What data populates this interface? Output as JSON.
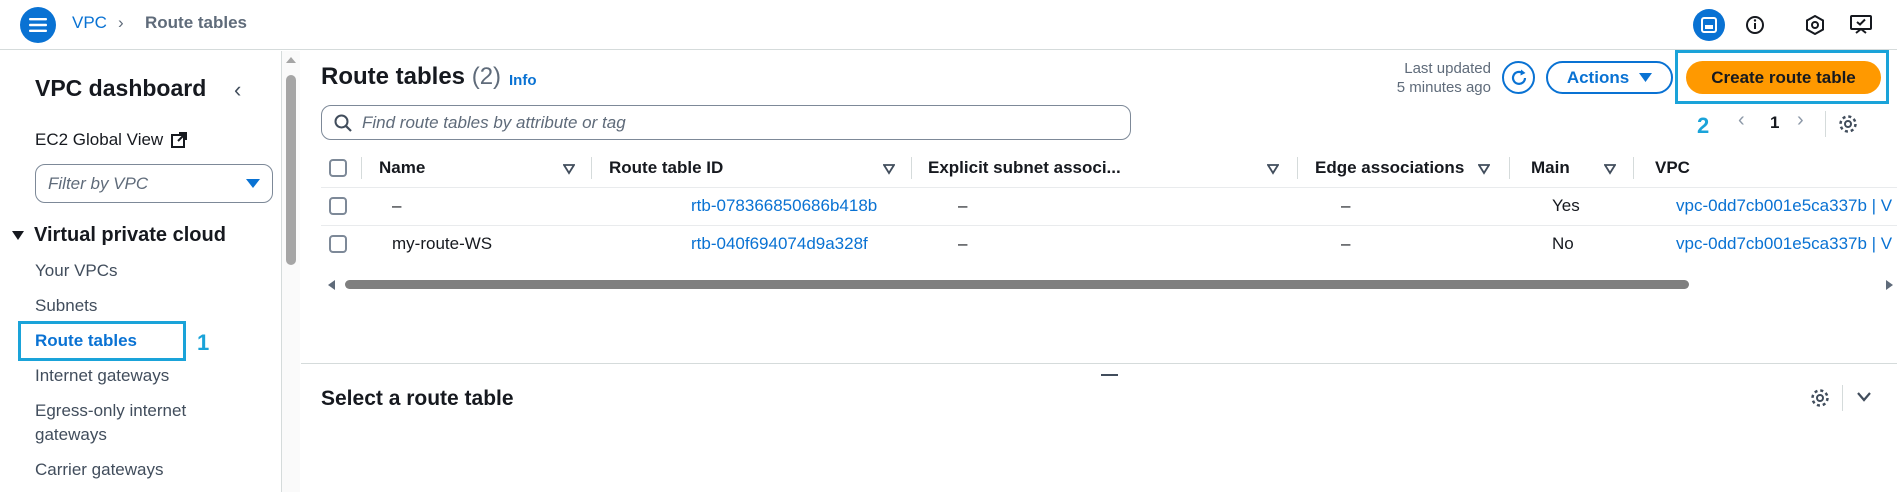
{
  "topbar": {
    "crumbs": [
      "VPC",
      "Route tables"
    ],
    "icons": [
      "menu-icon",
      "panel-icon",
      "info-circle-icon",
      "settings-hex-icon",
      "feedback-icon"
    ]
  },
  "sidebar": {
    "title": "VPC dashboard",
    "global_view": "EC2 Global View",
    "filter_placeholder": "Filter by VPC",
    "section": "Virtual private cloud",
    "items": [
      "Your VPCs",
      "Subnets",
      "Route tables",
      "Internet gateways",
      "Egress-only internet gateways",
      "Carrier gateways"
    ],
    "active_item": "Route tables"
  },
  "header": {
    "title": "Route tables",
    "count": "(2)",
    "info": "Info",
    "last_updated_line1": "Last updated",
    "last_updated_line2": "5 minutes ago",
    "actions_label": "Actions",
    "create_label": "Create route table"
  },
  "search": {
    "placeholder": "Find route tables by attribute or tag"
  },
  "pagination": {
    "page": "1"
  },
  "table": {
    "columns": [
      "Name",
      "Route table ID",
      "Explicit subnet associ...",
      "Edge associations",
      "Main",
      "VPC"
    ],
    "rows": [
      {
        "name": "–",
        "id": "rtb-078366850686b418b",
        "subnet": "–",
        "edge": "–",
        "main": "Yes",
        "vpc": "vpc-0dd7cb001e5ca337b | V"
      },
      {
        "name": "my-route-WS",
        "id": "rtb-040f694074d9a328f",
        "subnet": "–",
        "edge": "–",
        "main": "No",
        "vpc": "vpc-0dd7cb001e5ca337b | V"
      }
    ]
  },
  "detail": {
    "title": "Select a route table"
  },
  "annotations": {
    "marker1": "1",
    "marker2": "2",
    "color": "#1aa3d9"
  },
  "colors": {
    "primary": "#0972d3",
    "create_button": "#ff9900"
  }
}
